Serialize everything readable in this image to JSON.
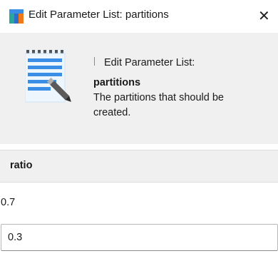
{
  "window": {
    "title": "Edit Parameter List: partitions",
    "close_glyph": "✕"
  },
  "header": {
    "line1": "Edit Parameter List:",
    "parameter_name": "partitions",
    "description_line1": "The partitions that should be",
    "description_line2": "created.",
    "icon": "notepad-pencil-icon"
  },
  "table": {
    "columns": [
      "ratio"
    ],
    "rows": [
      {
        "ratio": "0.7"
      },
      {
        "ratio": "0.3"
      }
    ]
  },
  "colors": {
    "header_bg": "#f0f0f0",
    "icon_blue": "#3a8ee6",
    "icon_teal": "#2aa79b",
    "icon_orange": "#f07a1a"
  }
}
